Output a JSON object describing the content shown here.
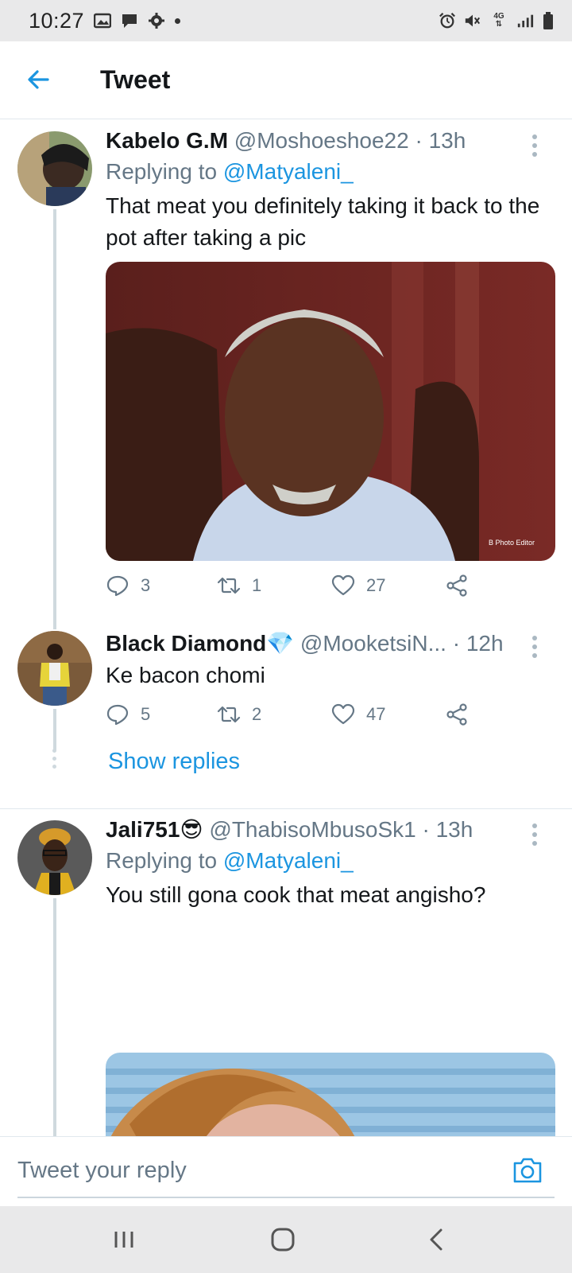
{
  "status_bar": {
    "time": "10:27",
    "network": "4G"
  },
  "header": {
    "title": "Tweet"
  },
  "tweets": [
    {
      "name": "Kabelo G.M",
      "handle": "@Moshoeshoe22",
      "separator": "·",
      "time": "13h",
      "replying_prefix": "Replying to",
      "replying_to": "@Matyaleni_",
      "text": "That meat you definitely taking it back to the pot after taking a pic",
      "media_watermark": "B Photo Editor",
      "replies": "3",
      "retweets": "1",
      "likes": "27"
    },
    {
      "name": "Black Diamond💎",
      "handle": "@MooketsiN...",
      "separator": "·",
      "time": "12h",
      "text": "Ke bacon chomi",
      "replies": "5",
      "retweets": "2",
      "likes": "47",
      "show_replies": "Show replies"
    },
    {
      "name": "Jali751😎",
      "handle": "@ThabisoMbusoSk1",
      "separator": "·",
      "time": "13h",
      "replying_prefix": "Replying to",
      "replying_to": "@Matyaleni_",
      "text": "You still gona cook that meat angisho?"
    }
  ],
  "reply_bar": {
    "placeholder": "Tweet your reply"
  },
  "colors": {
    "accent": "#1b95e0",
    "muted": "#657786",
    "text": "#14171a",
    "divider": "#e1e8ed"
  }
}
